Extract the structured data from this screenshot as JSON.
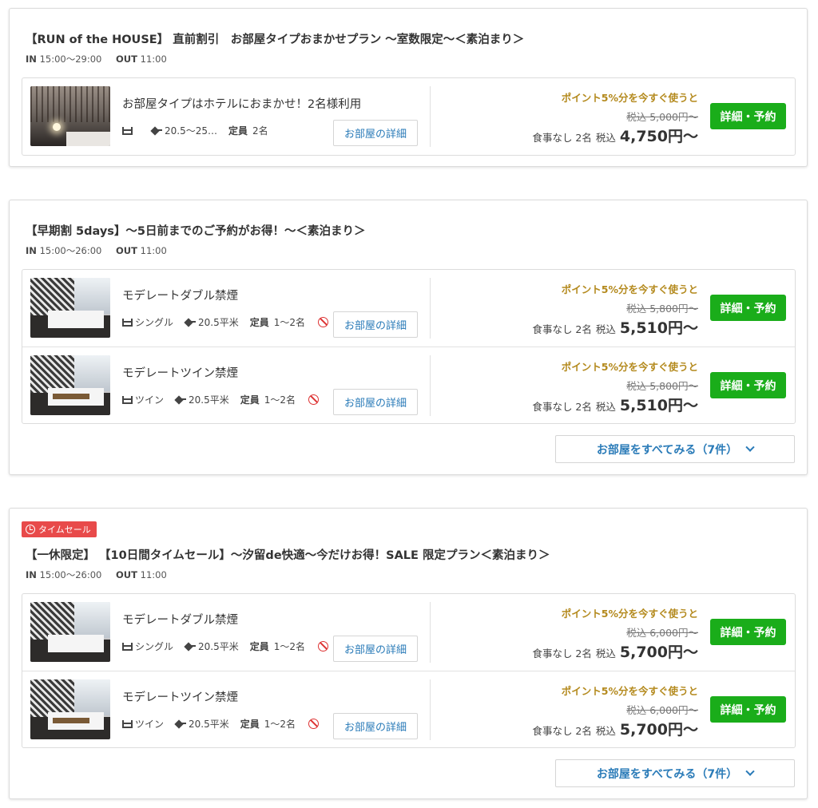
{
  "plans": [
    {
      "title": "【RUN of the HOUSE】 直前割引　お部屋タイプおまかせプラン ～室数限定～＜素泊まり＞",
      "checkin_label": "IN",
      "checkin": "15:00～29:00",
      "checkout_label": "OUT",
      "checkout": "11:00",
      "rooms": [
        {
          "name": "お部屋タイプはホテルにおまかせ！2名様利用",
          "bed": "",
          "area": "20.5～25…",
          "capacity_label": "定員",
          "capacity": "2名",
          "nosmoking": false,
          "detail_label": "お部屋の詳細",
          "point_note": "ポイント5%分を今すぐ使うと",
          "orig_price": "税込 5,000円～",
          "meal": "食事なし 2名",
          "tax_label": "税込",
          "price": "4,750円～",
          "reserve_label": "詳細・予約"
        }
      ]
    },
    {
      "title": "【早期割 5days】～5日前までのご予約がお得！～＜素泊まり＞",
      "checkin_label": "IN",
      "checkin": "15:00～26:00",
      "checkout_label": "OUT",
      "checkout": "11:00",
      "rooms": [
        {
          "name": "モデレートダブル禁煙",
          "bed": "シングル",
          "area": "20.5平米",
          "capacity_label": "定員",
          "capacity": "1～2名",
          "nosmoking": true,
          "detail_label": "お部屋の詳細",
          "point_note": "ポイント5%分を今すぐ使うと",
          "orig_price": "税込 5,800円～",
          "meal": "食事なし 2名",
          "tax_label": "税込",
          "price": "5,510円～",
          "reserve_label": "詳細・予約"
        },
        {
          "name": "モデレートツイン禁煙",
          "bed": "ツイン",
          "area": "20.5平米",
          "capacity_label": "定員",
          "capacity": "1～2名",
          "nosmoking": true,
          "detail_label": "お部屋の詳細",
          "point_note": "ポイント5%分を今すぐ使うと",
          "orig_price": "税込 5,800円～",
          "meal": "食事なし 2名",
          "tax_label": "税込",
          "price": "5,510円～",
          "reserve_label": "詳細・予約"
        }
      ],
      "see_all": "お部屋をすべてみる（7件）"
    },
    {
      "badge": "タイムセール",
      "title": "【一休限定】 【10日間タイムセール】～汐留de快適～今だけお得！SALE 限定プラン＜素泊まり＞",
      "checkin_label": "IN",
      "checkin": "15:00～26:00",
      "checkout_label": "OUT",
      "checkout": "11:00",
      "rooms": [
        {
          "name": "モデレートダブル禁煙",
          "bed": "シングル",
          "area": "20.5平米",
          "capacity_label": "定員",
          "capacity": "1～2名",
          "nosmoking": true,
          "detail_label": "お部屋の詳細",
          "point_note": "ポイント5%分を今すぐ使うと",
          "orig_price": "税込 6,000円～",
          "meal": "食事なし 2名",
          "tax_label": "税込",
          "price": "5,700円～",
          "reserve_label": "詳細・予約"
        },
        {
          "name": "モデレートツイン禁煙",
          "bed": "ツイン",
          "area": "20.5平米",
          "capacity_label": "定員",
          "capacity": "1～2名",
          "nosmoking": true,
          "detail_label": "お部屋の詳細",
          "point_note": "ポイント5%分を今すぐ使うと",
          "orig_price": "税込 6,000円～",
          "meal": "食事なし 2名",
          "tax_label": "税込",
          "price": "5,700円～",
          "reserve_label": "詳細・予約"
        }
      ],
      "see_all": "お部屋をすべてみる（7件）"
    }
  ],
  "colors": {
    "accent": "#2a7bb8",
    "reserve": "#1aad1a",
    "point": "#b48a1e",
    "badge": "#e84a4a"
  },
  "icons": {
    "bed": "bed-icon",
    "area": "area-icon",
    "nosmoking": "no-smoking-icon",
    "clock": "clock-icon",
    "chevron": "chevron-down-icon"
  }
}
